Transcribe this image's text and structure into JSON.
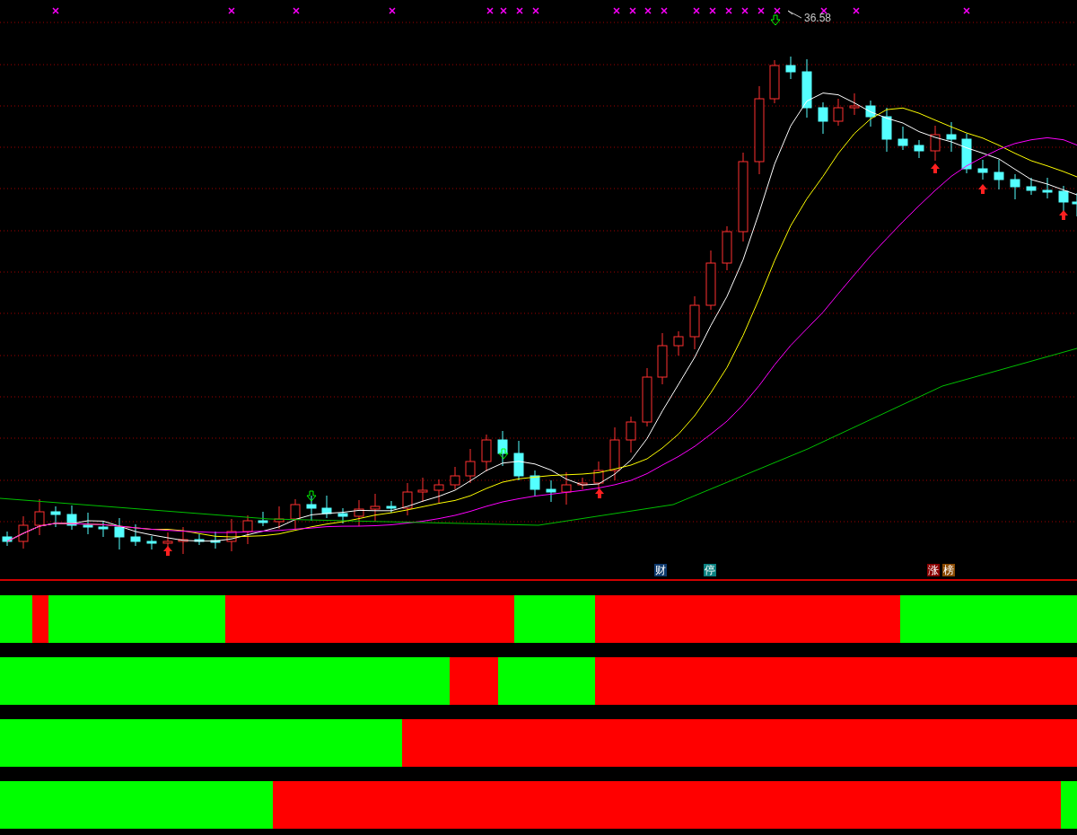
{
  "chart": {
    "price_label": "36.58",
    "badges": [
      {
        "text": "财",
        "color": "#0e3a6e"
      },
      {
        "text": "停",
        "color": "#0a8080"
      },
      {
        "text": "涨",
        "color": "#8a0000"
      },
      {
        "text": "榜",
        "color": "#8a4a00"
      }
    ]
  },
  "signal_strips": [
    {
      "cells": [
        {
          "color": "#00ff00"
        },
        {
          "color": "#00ff00"
        },
        {
          "color": "#ff0000"
        },
        {
          "color": "#00ff00"
        },
        {
          "color": "#00ff00"
        },
        {
          "color": "#00ff00"
        },
        {
          "color": "#00ff00"
        },
        {
          "color": "#00ff00"
        },
        {
          "color": "#00ff00"
        },
        {
          "color": "#00ff00"
        },
        {
          "color": "#00ff00"
        },
        {
          "color": "#00ff00"
        },
        {
          "color": "#00ff00"
        },
        {
          "color": "#00ff00"
        },
        {
          "color": "#ff0000"
        },
        {
          "color": "#ff0000"
        },
        {
          "color": "#ff0000"
        },
        {
          "color": "#ff0000"
        },
        {
          "color": "#ff0000"
        },
        {
          "color": "#ff0000"
        },
        {
          "color": "#ff0000"
        },
        {
          "color": "#ff0000"
        },
        {
          "color": "#ff0000"
        },
        {
          "color": "#ff0000"
        },
        {
          "color": "#ff0000"
        },
        {
          "color": "#ff0000"
        },
        {
          "color": "#ff0000"
        },
        {
          "color": "#ff0000"
        },
        {
          "color": "#ff0000"
        },
        {
          "color": "#ff0000"
        },
        {
          "color": "#ff0000"
        },
        {
          "color": "#ff0000"
        },
        {
          "color": "#00ff00"
        },
        {
          "color": "#00ff00"
        },
        {
          "color": "#00ff00"
        },
        {
          "color": "#00ff00"
        },
        {
          "color": "#00ff00"
        },
        {
          "color": "#ff0000"
        },
        {
          "color": "#ff0000"
        },
        {
          "color": "#ff0000"
        },
        {
          "color": "#ff0000"
        },
        {
          "color": "#ff0000"
        },
        {
          "color": "#ff0000"
        },
        {
          "color": "#ff0000"
        },
        {
          "color": "#ff0000"
        },
        {
          "color": "#ff0000"
        },
        {
          "color": "#ff0000"
        },
        {
          "color": "#ff0000"
        },
        {
          "color": "#ff0000"
        },
        {
          "color": "#ff0000"
        },
        {
          "color": "#ff0000"
        },
        {
          "color": "#ff0000"
        },
        {
          "color": "#ff0000"
        },
        {
          "color": "#ff0000"
        },
        {
          "color": "#ff0000"
        },
        {
          "color": "#ff0000"
        },
        {
          "color": "#00ff00"
        },
        {
          "color": "#00ff00"
        },
        {
          "color": "#00ff00"
        },
        {
          "color": "#00ff00"
        },
        {
          "color": "#00ff00"
        },
        {
          "color": "#00ff00"
        },
        {
          "color": "#00ff00"
        },
        {
          "color": "#00ff00"
        },
        {
          "color": "#00ff00"
        },
        {
          "color": "#00ff00"
        },
        {
          "color": "#00ff00"
        }
      ]
    },
    {
      "cells": [
        {
          "color": "#00ff00"
        },
        {
          "color": "#00ff00"
        },
        {
          "color": "#00ff00"
        },
        {
          "color": "#00ff00"
        },
        {
          "color": "#00ff00"
        },
        {
          "color": "#00ff00"
        },
        {
          "color": "#00ff00"
        },
        {
          "color": "#00ff00"
        },
        {
          "color": "#00ff00"
        },
        {
          "color": "#00ff00"
        },
        {
          "color": "#00ff00"
        },
        {
          "color": "#00ff00"
        },
        {
          "color": "#00ff00"
        },
        {
          "color": "#00ff00"
        },
        {
          "color": "#00ff00"
        },
        {
          "color": "#00ff00"
        },
        {
          "color": "#00ff00"
        },
        {
          "color": "#00ff00"
        },
        {
          "color": "#00ff00"
        },
        {
          "color": "#00ff00"
        },
        {
          "color": "#00ff00"
        },
        {
          "color": "#00ff00"
        },
        {
          "color": "#00ff00"
        },
        {
          "color": "#00ff00"
        },
        {
          "color": "#00ff00"
        },
        {
          "color": "#00ff00"
        },
        {
          "color": "#00ff00"
        },
        {
          "color": "#00ff00"
        },
        {
          "color": "#ff0000"
        },
        {
          "color": "#ff0000"
        },
        {
          "color": "#ff0000"
        },
        {
          "color": "#00ff00"
        },
        {
          "color": "#00ff00"
        },
        {
          "color": "#00ff00"
        },
        {
          "color": "#00ff00"
        },
        {
          "color": "#00ff00"
        },
        {
          "color": "#00ff00"
        },
        {
          "color": "#ff0000"
        },
        {
          "color": "#ff0000"
        },
        {
          "color": "#ff0000"
        },
        {
          "color": "#ff0000"
        },
        {
          "color": "#ff0000"
        },
        {
          "color": "#ff0000"
        },
        {
          "color": "#ff0000"
        },
        {
          "color": "#ff0000"
        },
        {
          "color": "#ff0000"
        },
        {
          "color": "#ff0000"
        },
        {
          "color": "#ff0000"
        },
        {
          "color": "#ff0000"
        },
        {
          "color": "#ff0000"
        },
        {
          "color": "#ff0000"
        },
        {
          "color": "#ff0000"
        },
        {
          "color": "#ff0000"
        },
        {
          "color": "#ff0000"
        },
        {
          "color": "#ff0000"
        },
        {
          "color": "#ff0000"
        },
        {
          "color": "#ff0000"
        },
        {
          "color": "#ff0000"
        },
        {
          "color": "#ff0000"
        },
        {
          "color": "#ff0000"
        },
        {
          "color": "#ff0000"
        },
        {
          "color": "#ff0000"
        },
        {
          "color": "#ff0000"
        },
        {
          "color": "#ff0000"
        },
        {
          "color": "#ff0000"
        },
        {
          "color": "#ff0000"
        },
        {
          "color": "#ff0000"
        }
      ]
    },
    {
      "cells": [
        {
          "color": "#00ff00"
        },
        {
          "color": "#00ff00"
        },
        {
          "color": "#00ff00"
        },
        {
          "color": "#00ff00"
        },
        {
          "color": "#00ff00"
        },
        {
          "color": "#00ff00"
        },
        {
          "color": "#00ff00"
        },
        {
          "color": "#00ff00"
        },
        {
          "color": "#00ff00"
        },
        {
          "color": "#00ff00"
        },
        {
          "color": "#00ff00"
        },
        {
          "color": "#00ff00"
        },
        {
          "color": "#00ff00"
        },
        {
          "color": "#00ff00"
        },
        {
          "color": "#00ff00"
        },
        {
          "color": "#00ff00"
        },
        {
          "color": "#00ff00"
        },
        {
          "color": "#00ff00"
        },
        {
          "color": "#00ff00"
        },
        {
          "color": "#00ff00"
        },
        {
          "color": "#00ff00"
        },
        {
          "color": "#00ff00"
        },
        {
          "color": "#00ff00"
        },
        {
          "color": "#00ff00"
        },
        {
          "color": "#00ff00"
        },
        {
          "color": "#ff0000"
        },
        {
          "color": "#ff0000"
        },
        {
          "color": "#ff0000"
        },
        {
          "color": "#ff0000"
        },
        {
          "color": "#ff0000"
        },
        {
          "color": "#ff0000"
        },
        {
          "color": "#ff0000"
        },
        {
          "color": "#ff0000"
        },
        {
          "color": "#ff0000"
        },
        {
          "color": "#ff0000"
        },
        {
          "color": "#ff0000"
        },
        {
          "color": "#ff0000"
        },
        {
          "color": "#ff0000"
        },
        {
          "color": "#ff0000"
        },
        {
          "color": "#ff0000"
        },
        {
          "color": "#ff0000"
        },
        {
          "color": "#ff0000"
        },
        {
          "color": "#ff0000"
        },
        {
          "color": "#ff0000"
        },
        {
          "color": "#ff0000"
        },
        {
          "color": "#ff0000"
        },
        {
          "color": "#ff0000"
        },
        {
          "color": "#ff0000"
        },
        {
          "color": "#ff0000"
        },
        {
          "color": "#ff0000"
        },
        {
          "color": "#ff0000"
        },
        {
          "color": "#ff0000"
        },
        {
          "color": "#ff0000"
        },
        {
          "color": "#ff0000"
        },
        {
          "color": "#ff0000"
        },
        {
          "color": "#ff0000"
        },
        {
          "color": "#ff0000"
        },
        {
          "color": "#ff0000"
        },
        {
          "color": "#ff0000"
        },
        {
          "color": "#ff0000"
        },
        {
          "color": "#ff0000"
        },
        {
          "color": "#ff0000"
        },
        {
          "color": "#ff0000"
        },
        {
          "color": "#ff0000"
        },
        {
          "color": "#ff0000"
        },
        {
          "color": "#ff0000"
        },
        {
          "color": "#ff0000"
        }
      ]
    },
    {
      "cells": [
        {
          "color": "#00ff00"
        },
        {
          "color": "#00ff00"
        },
        {
          "color": "#00ff00"
        },
        {
          "color": "#00ff00"
        },
        {
          "color": "#00ff00"
        },
        {
          "color": "#00ff00"
        },
        {
          "color": "#00ff00"
        },
        {
          "color": "#00ff00"
        },
        {
          "color": "#00ff00"
        },
        {
          "color": "#00ff00"
        },
        {
          "color": "#00ff00"
        },
        {
          "color": "#00ff00"
        },
        {
          "color": "#00ff00"
        },
        {
          "color": "#00ff00"
        },
        {
          "color": "#00ff00"
        },
        {
          "color": "#00ff00"
        },
        {
          "color": "#00ff00"
        },
        {
          "color": "#ff0000"
        },
        {
          "color": "#ff0000"
        },
        {
          "color": "#ff0000"
        },
        {
          "color": "#ff0000"
        },
        {
          "color": "#ff0000"
        },
        {
          "color": "#ff0000"
        },
        {
          "color": "#ff0000"
        },
        {
          "color": "#ff0000"
        },
        {
          "color": "#ff0000"
        },
        {
          "color": "#ff0000"
        },
        {
          "color": "#ff0000"
        },
        {
          "color": "#ff0000"
        },
        {
          "color": "#ff0000"
        },
        {
          "color": "#ff0000"
        },
        {
          "color": "#ff0000"
        },
        {
          "color": "#ff0000"
        },
        {
          "color": "#ff0000"
        },
        {
          "color": "#ff0000"
        },
        {
          "color": "#ff0000"
        },
        {
          "color": "#ff0000"
        },
        {
          "color": "#ff0000"
        },
        {
          "color": "#ff0000"
        },
        {
          "color": "#ff0000"
        },
        {
          "color": "#ff0000"
        },
        {
          "color": "#ff0000"
        },
        {
          "color": "#ff0000"
        },
        {
          "color": "#ff0000"
        },
        {
          "color": "#ff0000"
        },
        {
          "color": "#ff0000"
        },
        {
          "color": "#ff0000"
        },
        {
          "color": "#ff0000"
        },
        {
          "color": "#ff0000"
        },
        {
          "color": "#ff0000"
        },
        {
          "color": "#ff0000"
        },
        {
          "color": "#ff0000"
        },
        {
          "color": "#ff0000"
        },
        {
          "color": "#ff0000"
        },
        {
          "color": "#ff0000"
        },
        {
          "color": "#ff0000"
        },
        {
          "color": "#ff0000"
        },
        {
          "color": "#ff0000"
        },
        {
          "color": "#ff0000"
        },
        {
          "color": "#ff0000"
        },
        {
          "color": "#ff0000"
        },
        {
          "color": "#ff0000"
        },
        {
          "color": "#ff0000"
        },
        {
          "color": "#ff0000"
        },
        {
          "color": "#ff0000"
        },
        {
          "color": "#ff0000"
        },
        {
          "color": "#00ff00"
        }
      ]
    }
  ]
}
